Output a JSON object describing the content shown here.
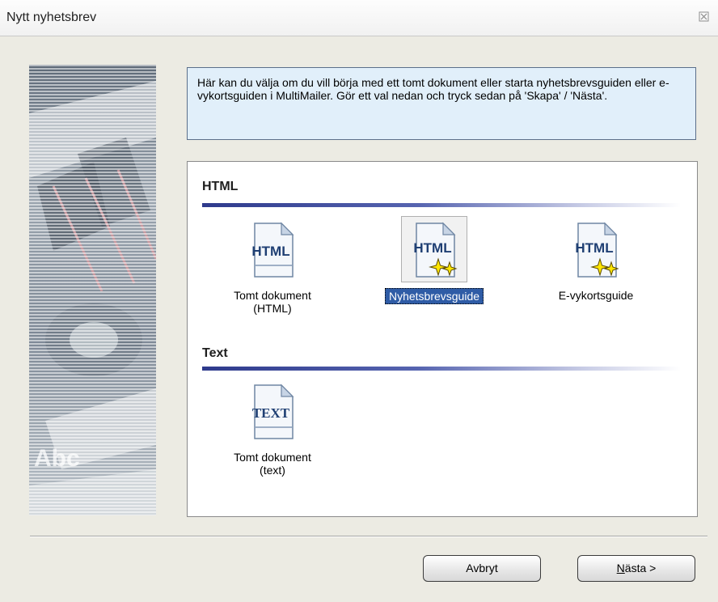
{
  "window": {
    "title": "Nytt nyhetsbrev"
  },
  "info": {
    "text": "Här kan du välja om du vill börja med ett tomt dokument eller starta nyhetsbrevsguiden eller e-vykortsguiden i MultiMailer. Gör ett val nedan och tryck sedan på 'Skapa' / 'Nästa'."
  },
  "sections": [
    {
      "title": "HTML",
      "items": [
        {
          "label_line1": "Tomt dokument",
          "label_line2": "(HTML)",
          "icon_text": "HTML",
          "icon": "html-document-icon",
          "selected": false
        },
        {
          "label_line1": "Nyhetsbrevsguide",
          "label_line2": "",
          "icon_text": "HTML",
          "icon": "html-wizard-icon",
          "selected": true
        },
        {
          "label_line1": "E-vykortsguide",
          "label_line2": "",
          "icon_text": "HTML",
          "icon": "html-wizard-icon",
          "selected": false
        }
      ]
    },
    {
      "title": "Text",
      "items": [
        {
          "label_line1": "Tomt dokument",
          "label_line2": "(text)",
          "icon_text": "TEXT",
          "icon": "text-document-icon",
          "selected": false
        }
      ]
    }
  ],
  "side_art": {
    "watermark_text": "Abc"
  },
  "buttons": {
    "cancel": "Avbryt",
    "next_mnemonic": "N",
    "next_rest": "ästa >"
  },
  "colors": {
    "selection": "#2f5ca6",
    "info_background": "#e1effa",
    "section_rule": "#2e3a8c"
  }
}
